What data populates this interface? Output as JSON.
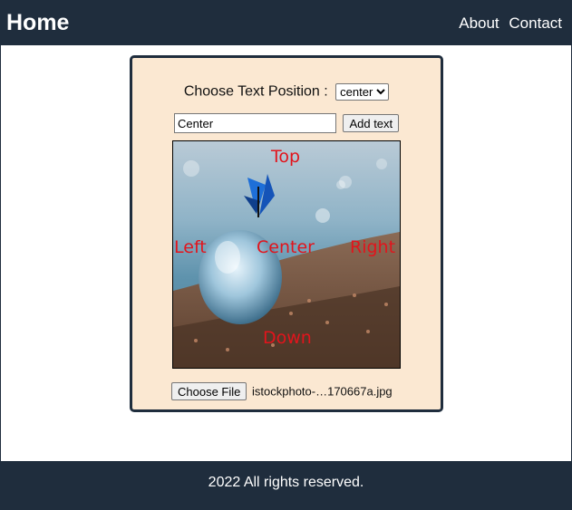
{
  "navbar": {
    "brand": "Home",
    "links": [
      "About",
      "Contact"
    ]
  },
  "form": {
    "position_label": "Choose Text Position :",
    "position_selected": "center",
    "text_value": "Center",
    "add_button": "Add text",
    "overlay_labels": {
      "top": "Top",
      "left": "Left",
      "center": "Center",
      "right": "Right",
      "down": "Down"
    },
    "file_button": "Choose File",
    "file_name": "istockphoto-…170667a.jpg"
  },
  "footer": {
    "text": "2022 All rights reserved."
  }
}
